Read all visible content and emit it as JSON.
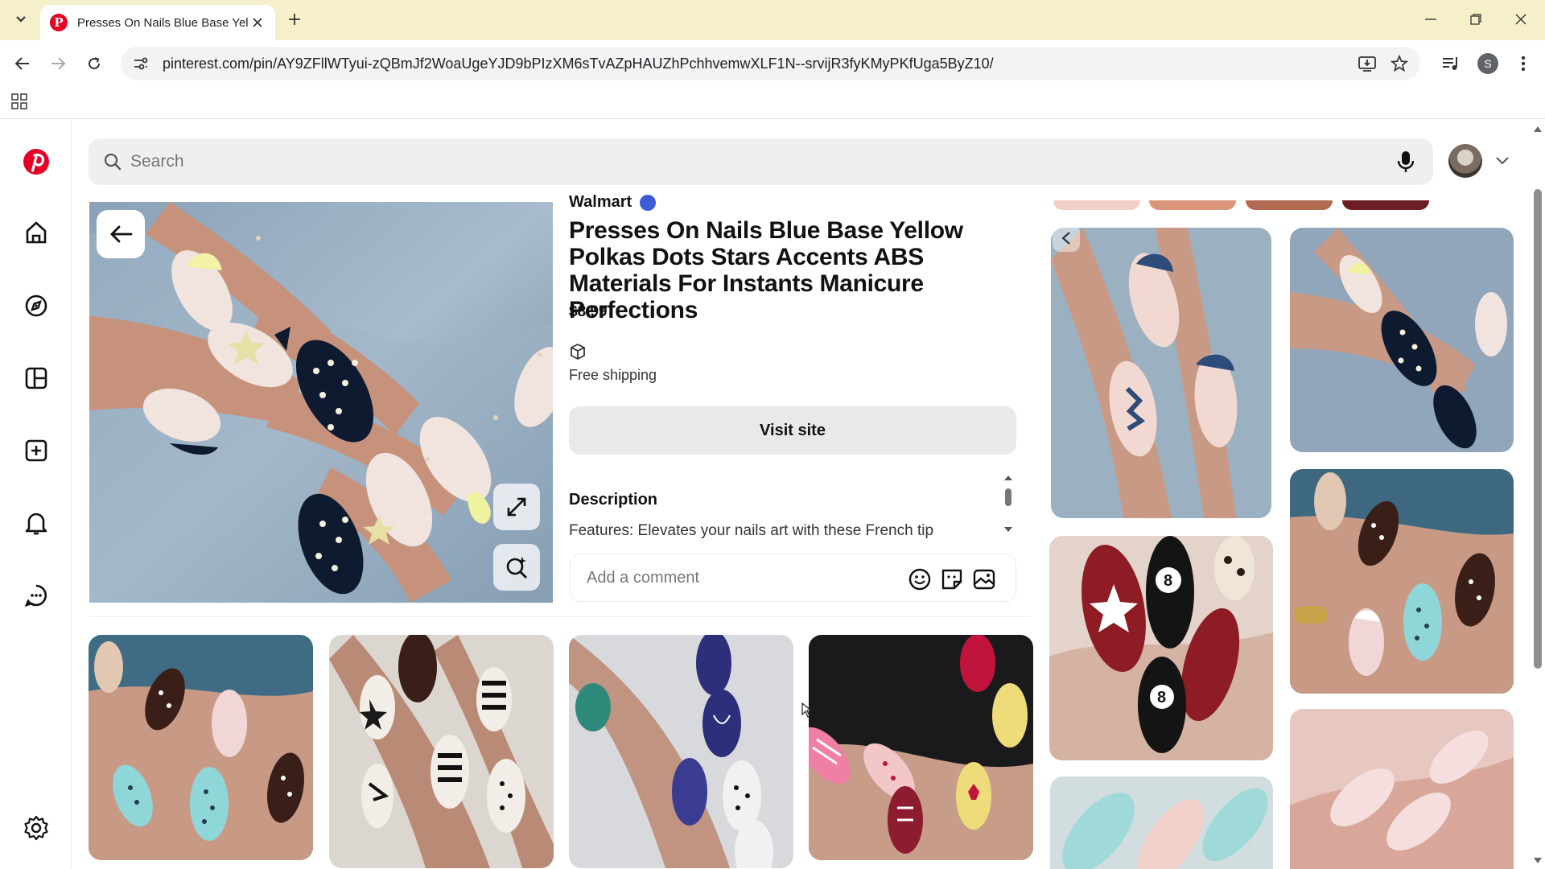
{
  "browser": {
    "tab_title": "Presses On Nails Blue Base Yellow Polkas Dots Stars Accents ABS Materials For Instants Manicure Perfections",
    "url": "pinterest.com/pin/AY9ZFllWTyui-zQBmJf2WoaUgeYJD9bPIzXM6sTvAZpHAUZhPchhvemwXLF1N--srvijR3fyKMyPKfUga5ByZ10/",
    "profile_initial": "S"
  },
  "pinterest": {
    "search_placeholder": "Search",
    "pin": {
      "store": "Walmart",
      "title": "Presses On Nails Blue Base Yellow Polkas Dots Stars Accents ABS Materials For Instants Manicure Perfections",
      "price": "$8.99",
      "shipping": "Free shipping",
      "visit_button": "Visit site",
      "description_heading": "Description",
      "description_text": "Features: Elevates your nails art with these French tip",
      "comment_placeholder": "Add a comment"
    }
  },
  "colors": {
    "pinterest_red": "#e60023",
    "tab_strip": "#f5f0c9",
    "verified_badge": "#3e5bd9"
  }
}
